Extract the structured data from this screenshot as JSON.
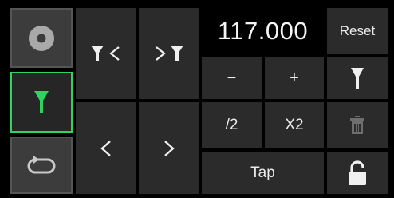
{
  "modes": [
    {
      "name": "record",
      "icon": "disc-icon",
      "active": false
    },
    {
      "name": "marker",
      "icon": "marker-icon",
      "active": true
    },
    {
      "name": "loop",
      "icon": "loop-icon",
      "active": false
    }
  ],
  "position_value": "117.000",
  "buttons": {
    "reset": "Reset",
    "minus": "−",
    "plus": "+",
    "half": "/2",
    "double": "X2",
    "tap": "Tap"
  },
  "colors": {
    "accent_green": "#2fd35f",
    "button_bg": "#2b2b2b",
    "disabled": "#6e6e6e"
  }
}
